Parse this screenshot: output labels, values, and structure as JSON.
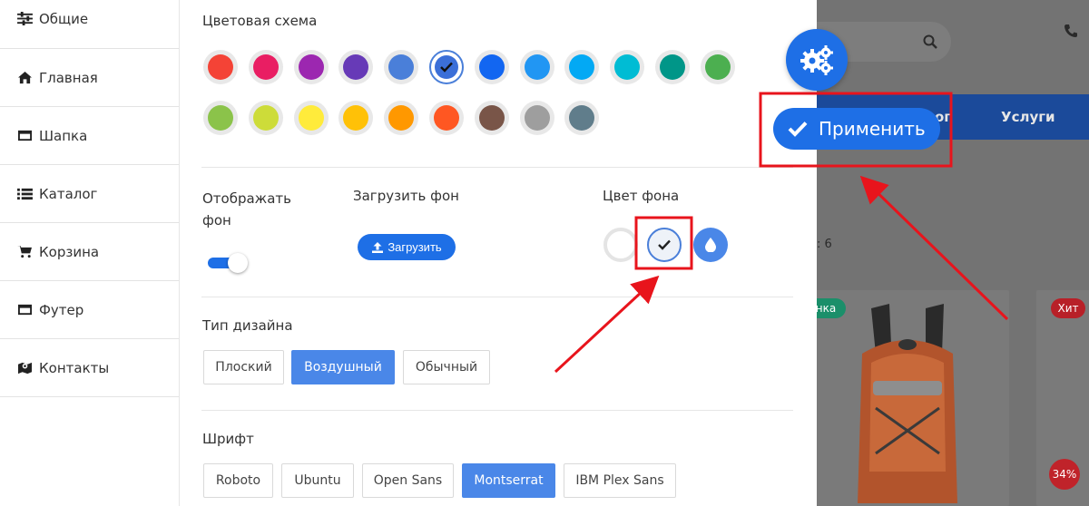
{
  "sidebar": {
    "items": [
      {
        "label": "Общие",
        "icon": "sliders-icon"
      },
      {
        "label": "Главная",
        "icon": "home-icon"
      },
      {
        "label": "Шапка",
        "icon": "window-icon"
      },
      {
        "label": "Каталог",
        "icon": "list-icon"
      },
      {
        "label": "Корзина",
        "icon": "cart-icon"
      },
      {
        "label": "Футер",
        "icon": "window-icon"
      },
      {
        "label": "Контакты",
        "icon": "map-marker-icon"
      }
    ]
  },
  "color_scheme": {
    "title": "Цветовая схема",
    "colors_row1": [
      "#f44336",
      "#e91e63",
      "#9c27b0",
      "#673ab7",
      "#4a7fd9",
      "#3b6fd8",
      "#1266f1",
      "#2196f3",
      "#03a9f4",
      "#00bcd4",
      "#009688",
      "#4caf50"
    ],
    "colors_row2": [
      "#8bc34a",
      "#cddc39",
      "#ffeb3b",
      "#ffc107",
      "#ff9800",
      "#ff5722",
      "#795548",
      "#9e9e9e",
      "#607d8b"
    ],
    "selected_index": 5
  },
  "background": {
    "show_label": "Отображать фон",
    "upload_label": "Загрузить фон",
    "upload_button": "Загрузить",
    "color_label": "Цвет фона",
    "toggle_on": true
  },
  "design": {
    "title": "Тип дизайна",
    "options": [
      "Плоский",
      "Воздушный",
      "Обычный"
    ],
    "active": "Воздушный"
  },
  "font": {
    "title": "Шрифт",
    "options": [
      "Roboto",
      "Ubuntu",
      "Open Sans",
      "Montserrat",
      "IBM Plex Sans"
    ],
    "active": "Montserrat"
  },
  "floating": {
    "apply_label": "Применить"
  },
  "preview": {
    "nav_partial": "ог",
    "nav_services": "Услуги",
    "count_partial": ": 6",
    "tag1": "нка",
    "tag2": "Хит",
    "discount": "34%"
  },
  "colors": {
    "accent": "#1e6fe6",
    "annotation": "#e8141c",
    "nav": "#1b4a9a"
  }
}
